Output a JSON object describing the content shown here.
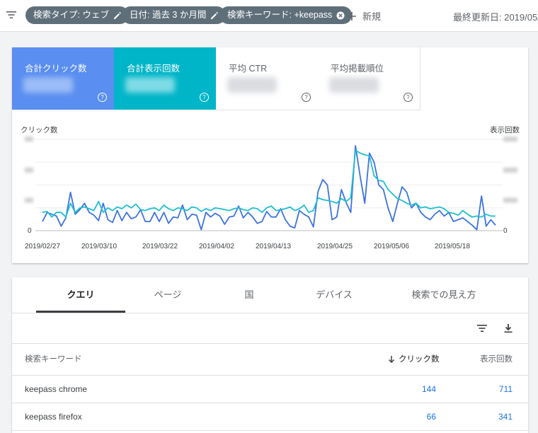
{
  "topbar": {
    "chips": [
      {
        "label": "検索タイプ: ウェブ",
        "icon": "edit-icon"
      },
      {
        "label": "日付: 過去 3 か月間",
        "icon": "edit-icon"
      },
      {
        "label": "検索キーワード: +keepass",
        "icon": "clear-icon"
      }
    ],
    "add_label": "新規",
    "updated_label": "最終更新日: 2019/05/2"
  },
  "metrics": [
    {
      "label": "合計クリック数",
      "color": "#5a8ef0",
      "selected": true
    },
    {
      "label": "合計表示回数",
      "color": "#00b5c8",
      "selected": true
    },
    {
      "label": "平均 CTR",
      "selected": false
    },
    {
      "label": "平均掲載順位",
      "selected": false
    }
  ],
  "chart": {
    "left_axis_title": "クリック数",
    "right_axis_title": "表示回数",
    "left_zero": "0",
    "right_zero": "0"
  },
  "chart_data": {
    "type": "line",
    "x_ticks": [
      "2019/02/27",
      "2019/03/10",
      "2019/03/22",
      "2019/04/02",
      "2019/04/13",
      "2019/04/25",
      "2019/05/06",
      "2019/05/18"
    ],
    "ylim": [
      0,
      1
    ],
    "series": [
      {
        "color": "#3d73e0",
        "values": [
          0.1,
          0.2,
          0.18,
          0.16,
          0.05,
          0.14,
          0.42,
          0.18,
          0.23,
          0.3,
          0.2,
          0.17,
          0.11,
          0.3,
          0.12,
          0.09,
          0.22,
          0.11,
          0.2,
          0.13,
          0.15,
          0.23,
          0.1,
          0.1,
          0.2,
          0.1,
          0.2,
          0.08,
          0.15,
          0.14,
          0.28,
          0.12,
          0.18,
          0.17,
          0.01,
          0.2,
          0.15,
          0.19,
          0.16,
          0.07,
          0.15,
          0.16,
          0.27,
          0.14,
          0.2,
          0.15,
          0.08,
          0.1,
          0.21,
          0.15,
          0.15,
          0.24,
          0.12,
          0.05,
          0.03,
          0.22,
          0.18,
          0.15,
          0.04,
          0.43,
          0.56,
          0.5,
          0.12,
          0.15,
          0.45,
          0.31,
          0.2,
          0.93,
          0.6,
          0.3,
          0.85,
          0.75,
          0.5,
          0.45,
          0.25,
          0.1,
          0.3,
          0.48,
          0.42,
          0.25,
          0.3,
          0.2,
          0.15,
          0.12,
          0.18,
          0.22,
          0.16,
          0.2,
          0.1,
          0.12,
          0.14,
          0.1,
          0.06,
          0.01,
          0.38,
          0.05,
          0.12,
          0.06
        ]
      },
      {
        "color": "#1fbfcf",
        "values": [
          0.2,
          0.21,
          0.15,
          0.2,
          0.2,
          0.15,
          0.3,
          0.2,
          0.25,
          0.26,
          0.24,
          0.22,
          0.32,
          0.2,
          0.25,
          0.22,
          0.26,
          0.24,
          0.28,
          0.25,
          0.29,
          0.23,
          0.22,
          0.24,
          0.25,
          0.22,
          0.28,
          0.24,
          0.22,
          0.25,
          0.24,
          0.22,
          0.26,
          0.25,
          0.21,
          0.24,
          0.22,
          0.25,
          0.24,
          0.23,
          0.22,
          0.24,
          0.25,
          0.23,
          0.22,
          0.25,
          0.24,
          0.2,
          0.25,
          0.27,
          0.22,
          0.23,
          0.24,
          0.26,
          0.22,
          0.24,
          0.28,
          0.2,
          0.22,
          0.36,
          0.34,
          0.33,
          0.32,
          0.3,
          0.35,
          0.32,
          0.36,
          0.88,
          0.85,
          0.83,
          0.82,
          0.6,
          0.55,
          0.54,
          0.45,
          0.4,
          0.35,
          0.33,
          0.3,
          0.28,
          0.3,
          0.25,
          0.26,
          0.24,
          0.25,
          0.26,
          0.24,
          0.2,
          0.19,
          0.17,
          0.22,
          0.18,
          0.15,
          0.16,
          0.15,
          0.18,
          0.16,
          0.16
        ]
      }
    ]
  },
  "table": {
    "tabs": [
      "クエリ",
      "ページ",
      "国",
      "デバイス",
      "検索での見え方"
    ],
    "active_tab": 0,
    "columns": {
      "query": "検索キーワード",
      "clicks": "クリック数",
      "impressions": "表示回数"
    },
    "rows": [
      {
        "query": "keepass chrome",
        "clicks": "144",
        "impressions": "711"
      },
      {
        "query": "keepass firefox",
        "clicks": "66",
        "impressions": "341"
      }
    ]
  }
}
